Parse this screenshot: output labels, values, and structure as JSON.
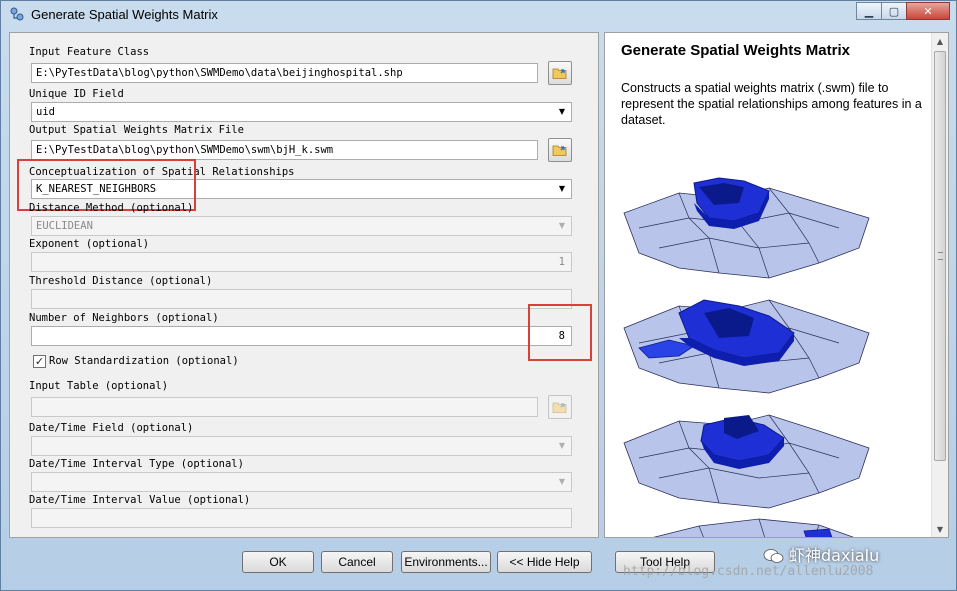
{
  "window": {
    "title": "Generate Spatial Weights Matrix",
    "minimize_icon": "minimize-icon",
    "maximize_icon": "maximize-icon",
    "close_icon": "close-icon"
  },
  "form": {
    "input_feature_class": {
      "label": "Input Feature Class",
      "value": "E:\\PyTestData\\blog\\python\\SWMDemo\\data\\beijinghospital.shp"
    },
    "unique_id_field": {
      "label": "Unique ID Field",
      "value": "uid"
    },
    "output_file": {
      "label": "Output Spatial Weights Matrix File",
      "value": "E:\\PyTestData\\blog\\python\\SWMDemo\\swm\\bjH_k.swm"
    },
    "conceptualization": {
      "label": "Conceptualization of Spatial Relationships",
      "value": "K_NEAREST_NEIGHBORS"
    },
    "distance_method": {
      "label": "Distance Method (optional)",
      "value": "EUCLIDEAN"
    },
    "exponent": {
      "label": "Exponent (optional)",
      "value": "1"
    },
    "threshold_distance": {
      "label": "Threshold Distance (optional)",
      "value": ""
    },
    "number_of_neighbors": {
      "label": "Number of Neighbors (optional)",
      "value": "8"
    },
    "row_standardization": {
      "label": "Row Standardization (optional)",
      "checked": true
    },
    "input_table": {
      "label": "Input Table (optional)",
      "value": ""
    },
    "date_time_field": {
      "label": "Date/Time Field (optional)",
      "value": ""
    },
    "date_time_interval_type": {
      "label": "Date/Time Interval Type (optional)",
      "value": ""
    },
    "date_time_interval_value": {
      "label": "Date/Time Interval Value (optional)",
      "value": ""
    }
  },
  "help": {
    "title": "Generate Spatial Weights Matrix",
    "description": "Constructs a spatial weights matrix (.swm) file to represent the spatial relationships among features in a dataset."
  },
  "buttons": {
    "ok": "OK",
    "cancel": "Cancel",
    "environments": "Environments...",
    "hide_help": "<< Hide Help",
    "tool_help": "Tool Help"
  },
  "watermark": {
    "text": "虾神daxialu",
    "url": "http://blog.csdn.net/allenlu2008"
  },
  "colors": {
    "highlight_box": "#d9403a",
    "map_light": "#b9c4ea",
    "map_dark": "#1f2fd6",
    "map_navy": "#0b1a8a"
  }
}
